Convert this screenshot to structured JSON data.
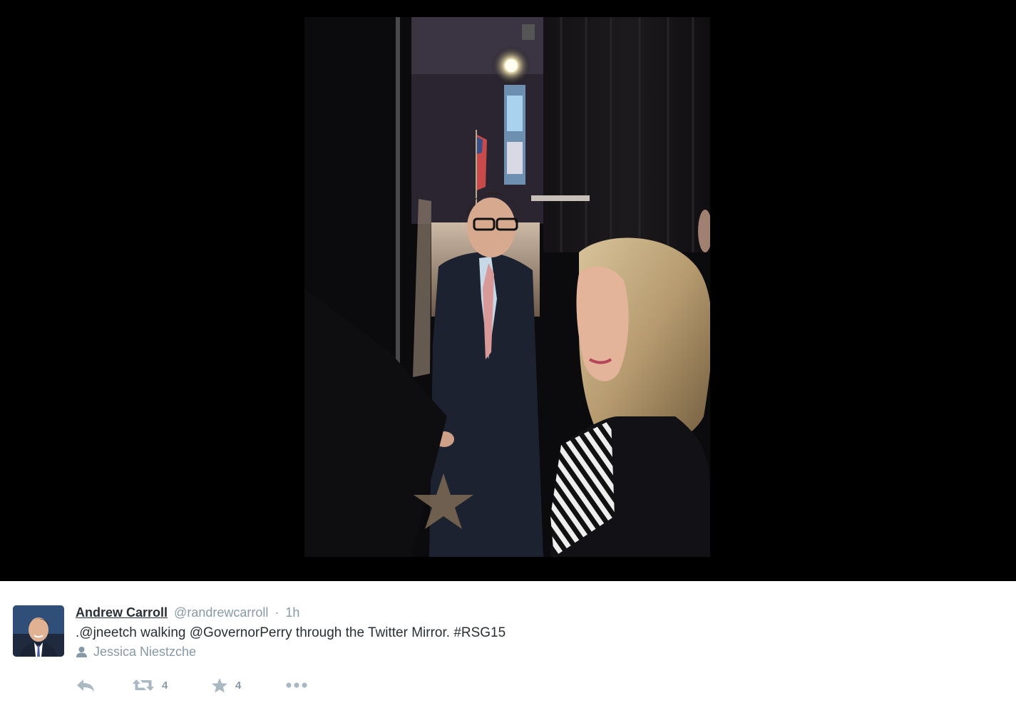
{
  "tweet": {
    "author_name": "Andrew Carroll",
    "author_handle": "@randrewcarroll",
    "separator": "·",
    "timestamp": "1h",
    "text": ".@jneetch walking @GovernorPerry through the Twitter Mirror. #RSG15",
    "tagged_person": "Jessica Niestzche",
    "retweet_count": "4",
    "favorite_count": "4"
  },
  "icons": {
    "reply": "reply-icon",
    "retweet": "retweet-icon",
    "favorite": "star-icon",
    "more": "more-dots-icon",
    "tagged": "person-icon"
  },
  "colors": {
    "stage_background": "#000000",
    "text_primary": "#292f33",
    "text_secondary": "#8899a6",
    "icon_gray": "#aab8c2"
  }
}
